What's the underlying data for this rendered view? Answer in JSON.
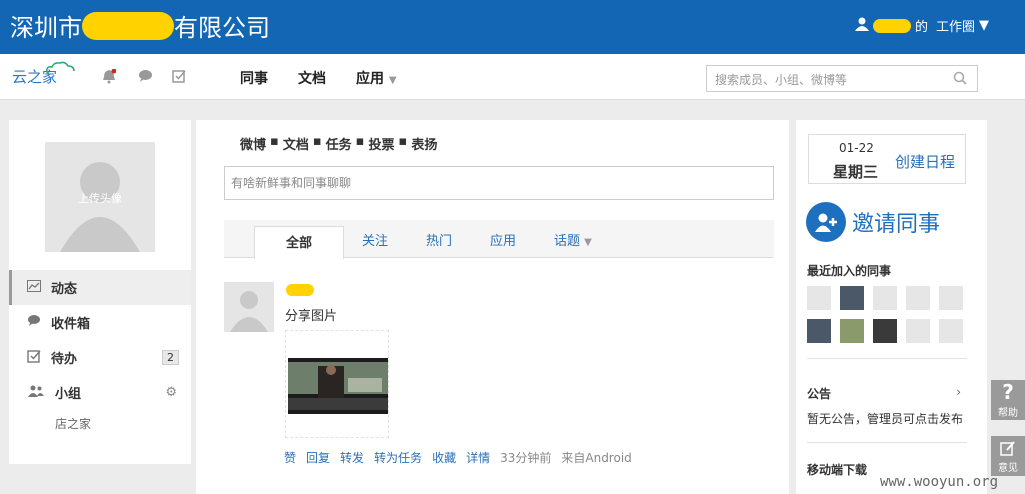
{
  "topbar": {
    "company_prefix": "深圳市",
    "company_suffix": "有限公司",
    "user_suffix": "的",
    "workspace": "工作圈"
  },
  "nav": {
    "logo": "云之家",
    "items": [
      "同事",
      "文档",
      "应用"
    ],
    "search_placeholder": "搜索成员、小组、微博等"
  },
  "left": {
    "avatar_label": "上传头像",
    "menu": [
      {
        "label": "动态",
        "icon": "chart-icon"
      },
      {
        "label": "收件箱",
        "icon": "chat-icon"
      },
      {
        "label": "待办",
        "icon": "check-icon",
        "badge": "2"
      },
      {
        "label": "小组",
        "icon": "group-icon"
      }
    ],
    "sub_item": "店之家"
  },
  "center": {
    "post_types": [
      "微博",
      "文档",
      "任务",
      "投票",
      "表扬"
    ],
    "compose_placeholder": "有啥新鲜事和同事聊聊",
    "tabs": [
      "全部",
      "关注",
      "热门",
      "应用",
      "话题"
    ],
    "post": {
      "text": "分享图片",
      "actions": [
        "赞",
        "回复",
        "转发",
        "转为任务",
        "收藏",
        "详情"
      ],
      "time": "33分钟前",
      "source": "来自Android"
    }
  },
  "right": {
    "date": "01-22",
    "weekday": "星期三",
    "create_schedule": "创建日程",
    "invite": "邀请同事",
    "recent_title": "最近加入的同事",
    "notice_title": "公告",
    "notice_text": "暂无公告，管理员可点击发布",
    "mobile_title": "移动端下载"
  },
  "side": {
    "help": "帮助",
    "feedback": "意见"
  },
  "watermark": "www.wooyun.org",
  "colors": {
    "brand_blue": "#1366b4",
    "link_blue": "#2a6fb8",
    "redaction_yellow": "#ffd200"
  }
}
